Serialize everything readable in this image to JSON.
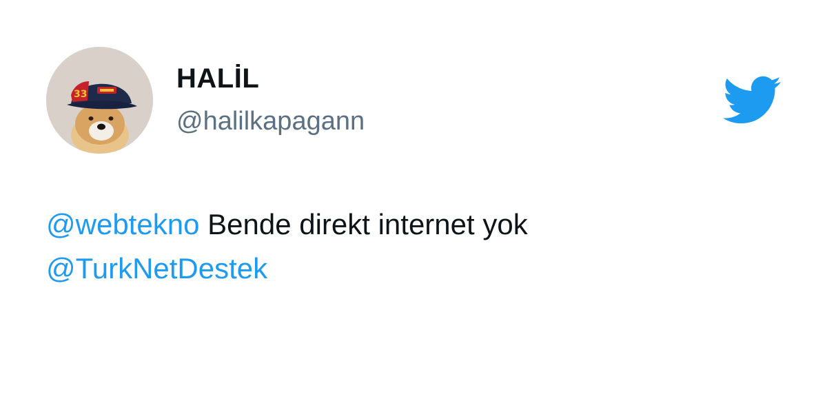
{
  "tweet": {
    "author": {
      "display_name": "HALİL",
      "handle": "@halilkapagann",
      "avatar": "dog-in-racing-cap-avatar"
    },
    "text": {
      "mention_1": "@webtekno",
      "body": " Bende direkt internet yok",
      "mention_2": "@TurkNetDestek"
    }
  },
  "brand": {
    "icon": "twitter-bird-icon",
    "color": "#1d9bf0"
  },
  "colors": {
    "text": "#0f1419",
    "secondary": "#5b7083",
    "link": "#1d9bf0"
  }
}
